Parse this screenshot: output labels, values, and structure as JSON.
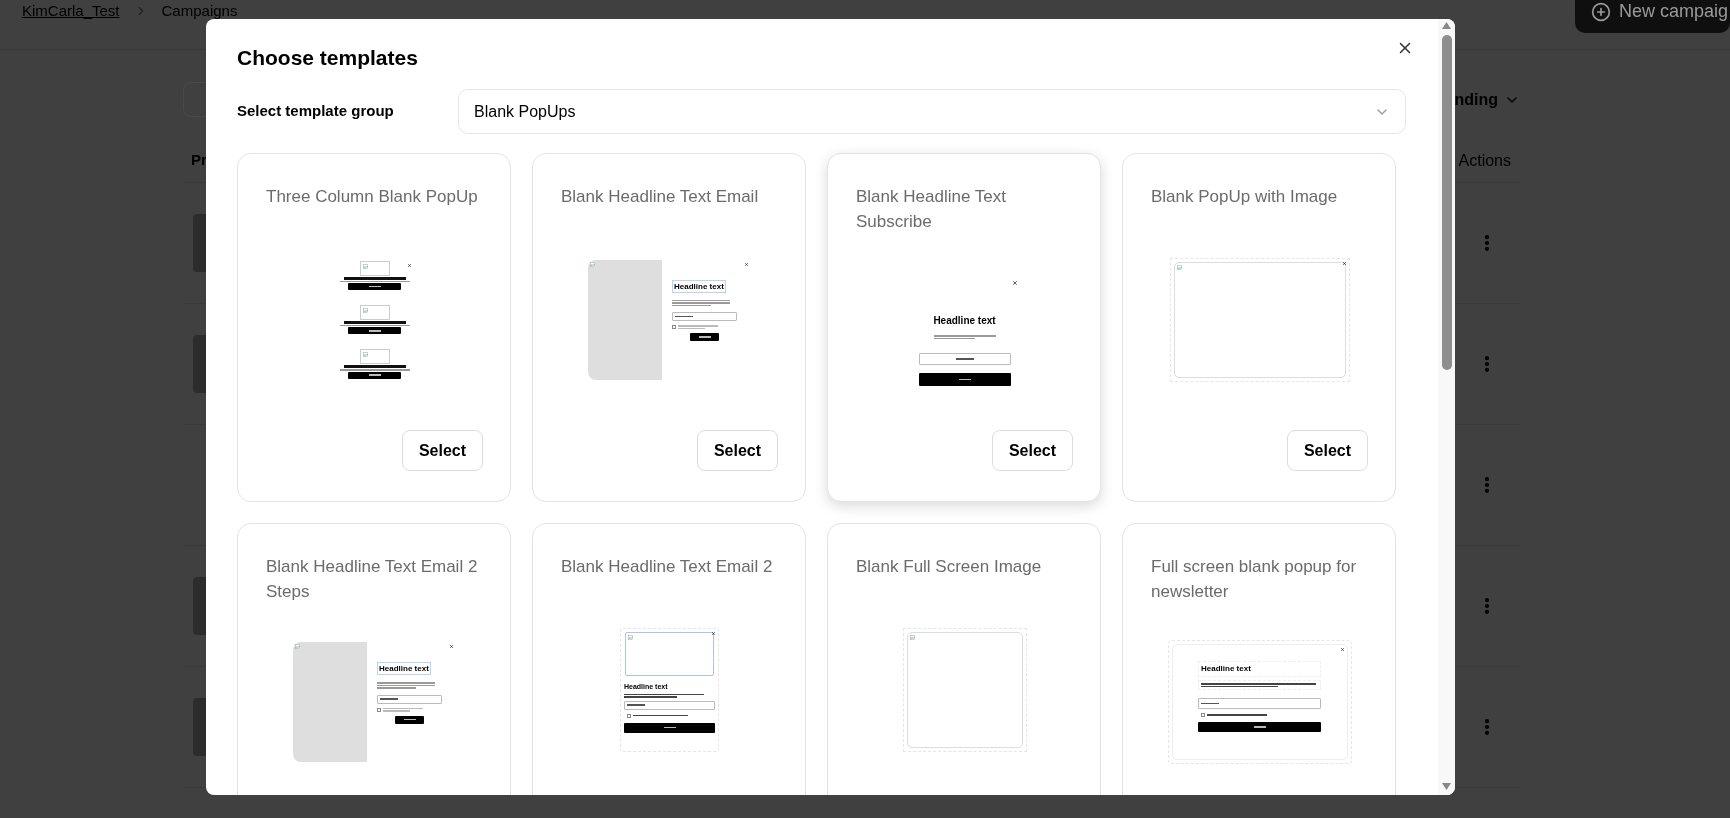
{
  "page": {
    "breadcrumb": [
      {
        "label": "KimCarla_Test",
        "link": true
      },
      {
        "label": "Campaigns",
        "link": false
      }
    ],
    "new_button": "New campaig",
    "sort_label": "nding",
    "column_1": "Pr",
    "column_actions": "Actions",
    "rows": [
      {
        "thumbnail": true
      },
      {
        "thumbnail": true
      },
      {
        "thumbnail": false
      },
      {
        "thumbnail": true
      },
      {
        "thumbnail": true
      }
    ]
  },
  "modal": {
    "title": "Choose templates",
    "group_label": "Select template group",
    "group_value": "Blank PopUps",
    "templates": [
      {
        "title": "Three Column Blank PopUp",
        "hovered": false,
        "select": "Select",
        "preview": {
          "kind": "three_column"
        }
      },
      {
        "title": "Blank Headline Text Email",
        "hovered": false,
        "select": "Select",
        "preview": {
          "kind": "split_form",
          "headline": "Headline text",
          "checked": false
        }
      },
      {
        "title": "Blank Headline Text Subscribe",
        "hovered": true,
        "select": "Select",
        "preview": {
          "kind": "centered_form",
          "headline": "Headline text"
        }
      },
      {
        "title": "Blank PopUp with Image",
        "hovered": false,
        "select": "Select",
        "preview": {
          "kind": "image_frame"
        }
      },
      {
        "title": "Blank Headline Text Email 2 Steps",
        "hovered": false,
        "preview": {
          "kind": "split_form",
          "headline": "Headline text",
          "checked": false
        }
      },
      {
        "title": "Blank Headline Text Email 2",
        "hovered": false,
        "preview": {
          "kind": "stacked_form",
          "headline": "Headline text",
          "checked": false
        }
      },
      {
        "title": "Blank Full Screen Image",
        "hovered": false,
        "preview": {
          "kind": "image_tall"
        }
      },
      {
        "title": "Full screen blank popup for newsletter",
        "hovered": false,
        "preview": {
          "kind": "full_form",
          "headline": "Headline text",
          "checked": false
        }
      }
    ]
  }
}
